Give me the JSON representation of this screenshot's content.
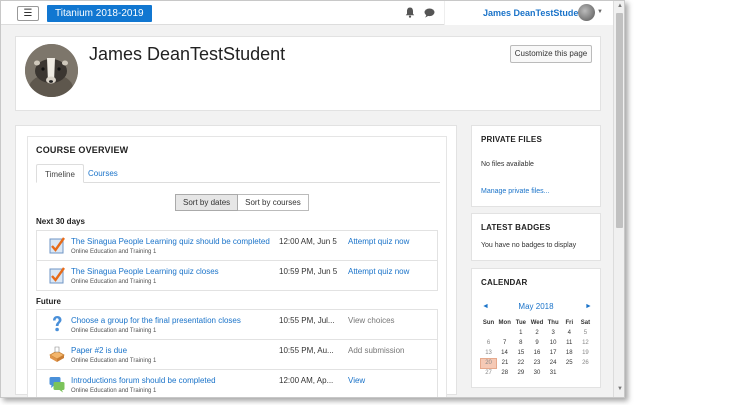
{
  "navbar": {
    "site_title": "Titanium 2018-2019",
    "user_name": "James DeanTestStudent"
  },
  "profile": {
    "name": "James DeanTestStudent",
    "customize_label": "Customize this page"
  },
  "course_overview": {
    "title": "COURSE OVERVIEW",
    "tabs": [
      {
        "label": "Timeline",
        "active": true
      },
      {
        "label": "Courses",
        "active": false
      }
    ],
    "sort_buttons": [
      {
        "label": "Sort by dates",
        "active": true
      },
      {
        "label": "Sort by courses",
        "active": false
      }
    ],
    "sections": [
      {
        "heading": "Next 30 days",
        "events": [
          {
            "icon": "quiz-icon",
            "title": "The Sinagua People Learning quiz should be completed",
            "course": "Online Education and Training 1",
            "time": "12:00 AM, Jun 5",
            "action": "Attempt quiz now",
            "action_muted": false
          },
          {
            "icon": "quiz-icon",
            "title": "The Sinagua People Learning quiz closes",
            "course": "Online Education and Training 1",
            "time": "10:59 PM, Jun 5",
            "action": "Attempt quiz now",
            "action_muted": false
          }
        ]
      },
      {
        "heading": "Future",
        "events": [
          {
            "icon": "choice-icon",
            "title": "Choose a group for the final presentation closes",
            "course": "Online Education and Training 1",
            "time": "10:55 PM, Jul...",
            "action": "View choices",
            "action_muted": true
          },
          {
            "icon": "assignment-icon",
            "title": "Paper #2 is due",
            "course": "Online Education and Training 1",
            "time": "10:55 PM, Au...",
            "action": "Add submission",
            "action_muted": true
          },
          {
            "icon": "forum-icon",
            "title": "Introductions forum should be completed",
            "course": "Online Education and Training 1",
            "time": "12:00 AM, Ap...",
            "action": "View",
            "action_muted": false
          }
        ]
      }
    ]
  },
  "private_files": {
    "title": "PRIVATE FILES",
    "empty_text": "No files available",
    "manage_link": "Manage private files..."
  },
  "latest_badges": {
    "title": "LATEST BADGES",
    "empty_text": "You have no badges to display"
  },
  "calendar": {
    "title": "CALENDAR",
    "month": "May 2018",
    "prev": "◄",
    "next": "►",
    "weekdays": [
      "Sun",
      "Mon",
      "Tue",
      "Wed",
      "Thu",
      "Fri",
      "Sat"
    ],
    "weeks": [
      [
        "",
        "",
        "1",
        "2",
        "3",
        "4",
        "5"
      ],
      [
        "6",
        "7",
        "8",
        "9",
        "10",
        "11",
        "12"
      ],
      [
        "13",
        "14",
        "15",
        "16",
        "17",
        "18",
        "19"
      ],
      [
        "20",
        "21",
        "22",
        "23",
        "24",
        "25",
        "26"
      ],
      [
        "27",
        "28",
        "29",
        "30",
        "31",
        "",
        ""
      ]
    ],
    "today": "20"
  },
  "colors": {
    "brand": "#1177d1",
    "link": "#1a73c9",
    "today_highlight": "#f5c9b5"
  }
}
